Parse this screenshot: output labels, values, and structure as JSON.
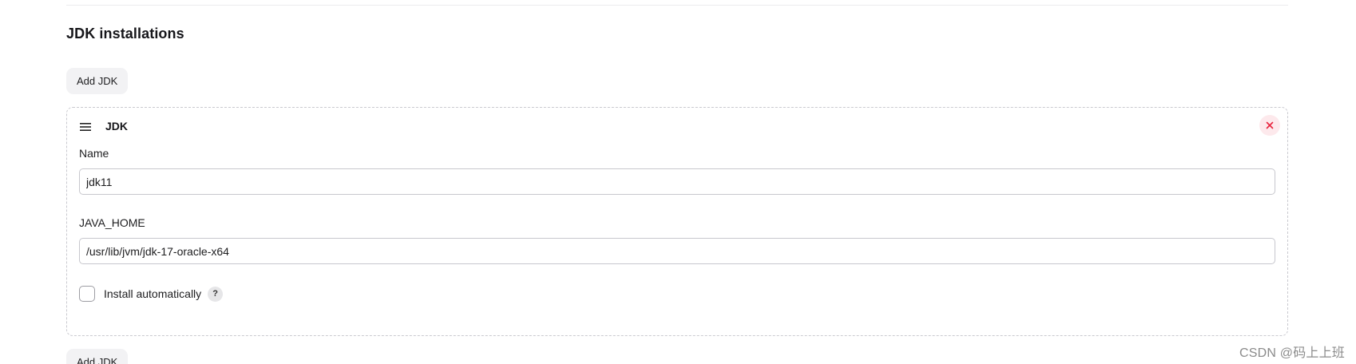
{
  "section": {
    "title": "JDK installations",
    "add_button_label": "Add JDK"
  },
  "jdk_card": {
    "title": "JDK",
    "name_label": "Name",
    "name_value": "jdk11",
    "java_home_label": "JAVA_HOME",
    "java_home_value": "/usr/lib/jvm/jdk-17-oracle-x64",
    "install_auto_label": "Install automatically",
    "install_auto_checked": false,
    "help_label": "?"
  },
  "icons": {
    "drag_handle": "hamburger-icon",
    "close": "close-icon"
  },
  "colors": {
    "close_icon": "#e8253f",
    "close_bg": "#fde9ec",
    "button_bg": "#f2f2f4",
    "card_border": "#c9c9cf"
  },
  "watermark": "CSDN @码上上班"
}
